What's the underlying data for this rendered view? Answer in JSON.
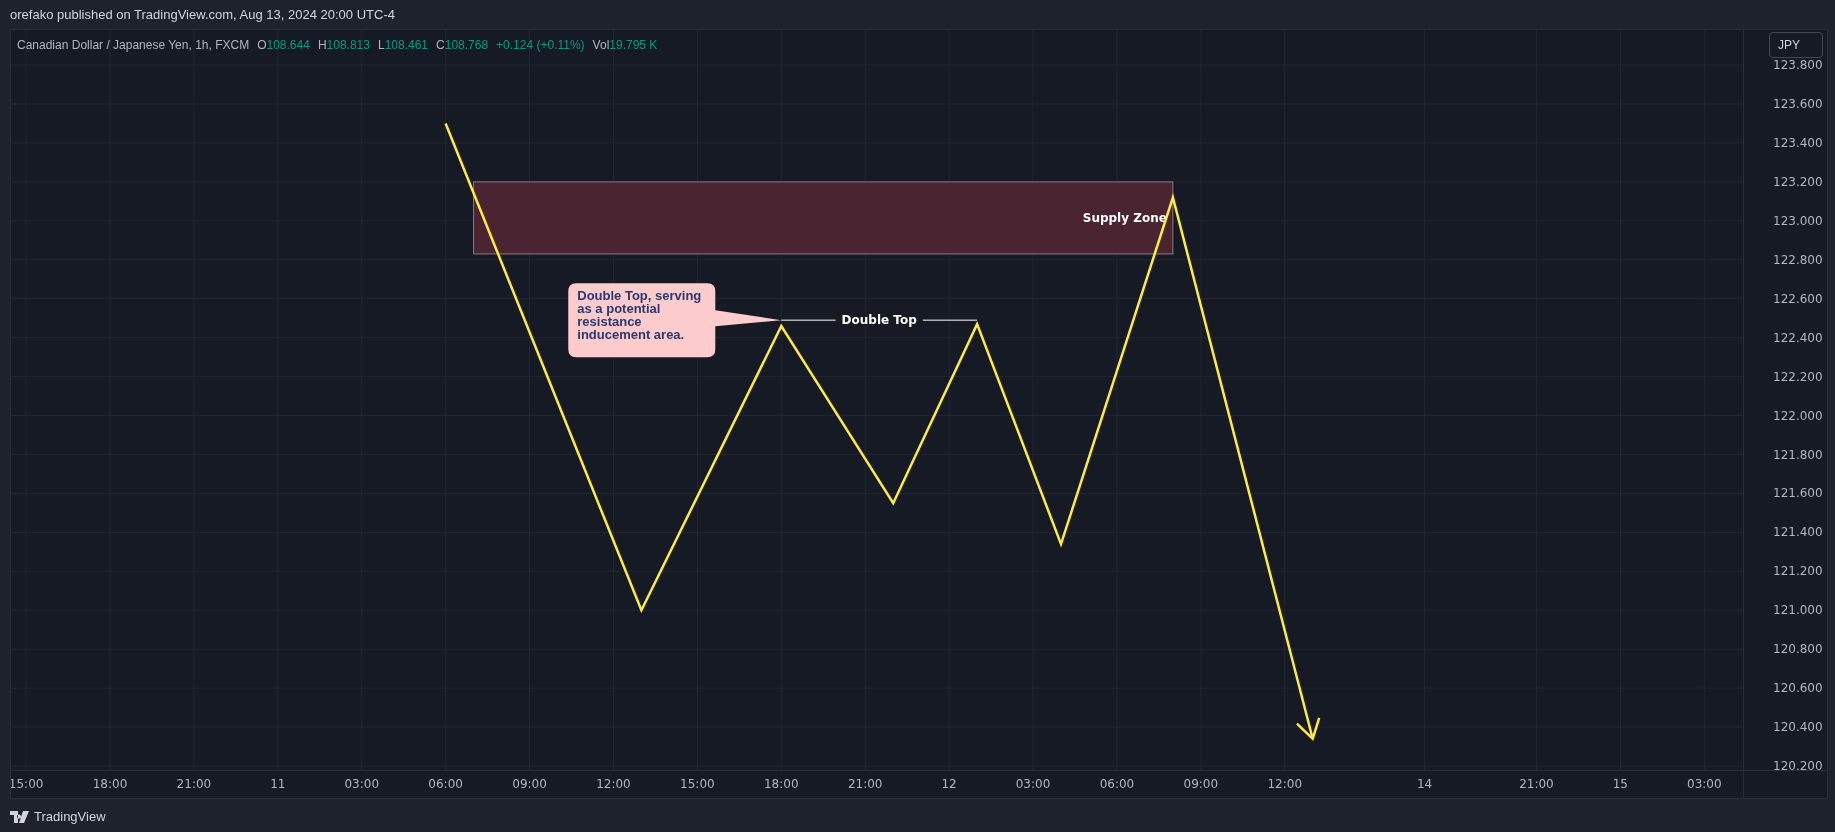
{
  "header": {
    "text": "orefako published on TradingView.com, Aug 13, 2024 20:00 UTC-4"
  },
  "chart": {
    "legend": {
      "symbol": "Canadian Dollar / Japanese Yen, 1h, FXCM",
      "ohlc": [
        {
          "label": "O",
          "value": "108.644"
        },
        {
          "label": "H",
          "value": "108.813"
        },
        {
          "label": "L",
          "value": "108.461"
        },
        {
          "label": "C",
          "value": "108.768"
        }
      ],
      "change": "+0.124 (+0.11%)",
      "volume": {
        "label": "Vol",
        "value": "19.795 K"
      }
    },
    "currency_button": "JPY",
    "price_axis": [
      "123.800",
      "123.600",
      "123.400",
      "123.200",
      "123.000",
      "122.800",
      "122.600",
      "122.400",
      "122.200",
      "122.000",
      "121.800",
      "121.600",
      "121.400",
      "121.200",
      "121.000",
      "120.800",
      "120.600",
      "120.400",
      "120.200"
    ],
    "time_axis": [
      "15:00",
      "18:00",
      "21:00",
      "11",
      "03:00",
      "06:00",
      "09:00",
      "12:00",
      "15:00",
      "18:00",
      "21:00",
      "12",
      "03:00",
      "06:00",
      "09:00",
      "12:00",
      "14",
      "21:00",
      "15",
      "03:00"
    ],
    "zone_label": "Supply Zone",
    "callout": "Double Top, serving as a potential resistance inducement area.",
    "level_label": "Double Top"
  },
  "footer": {
    "logo_text": "TradingView"
  }
}
